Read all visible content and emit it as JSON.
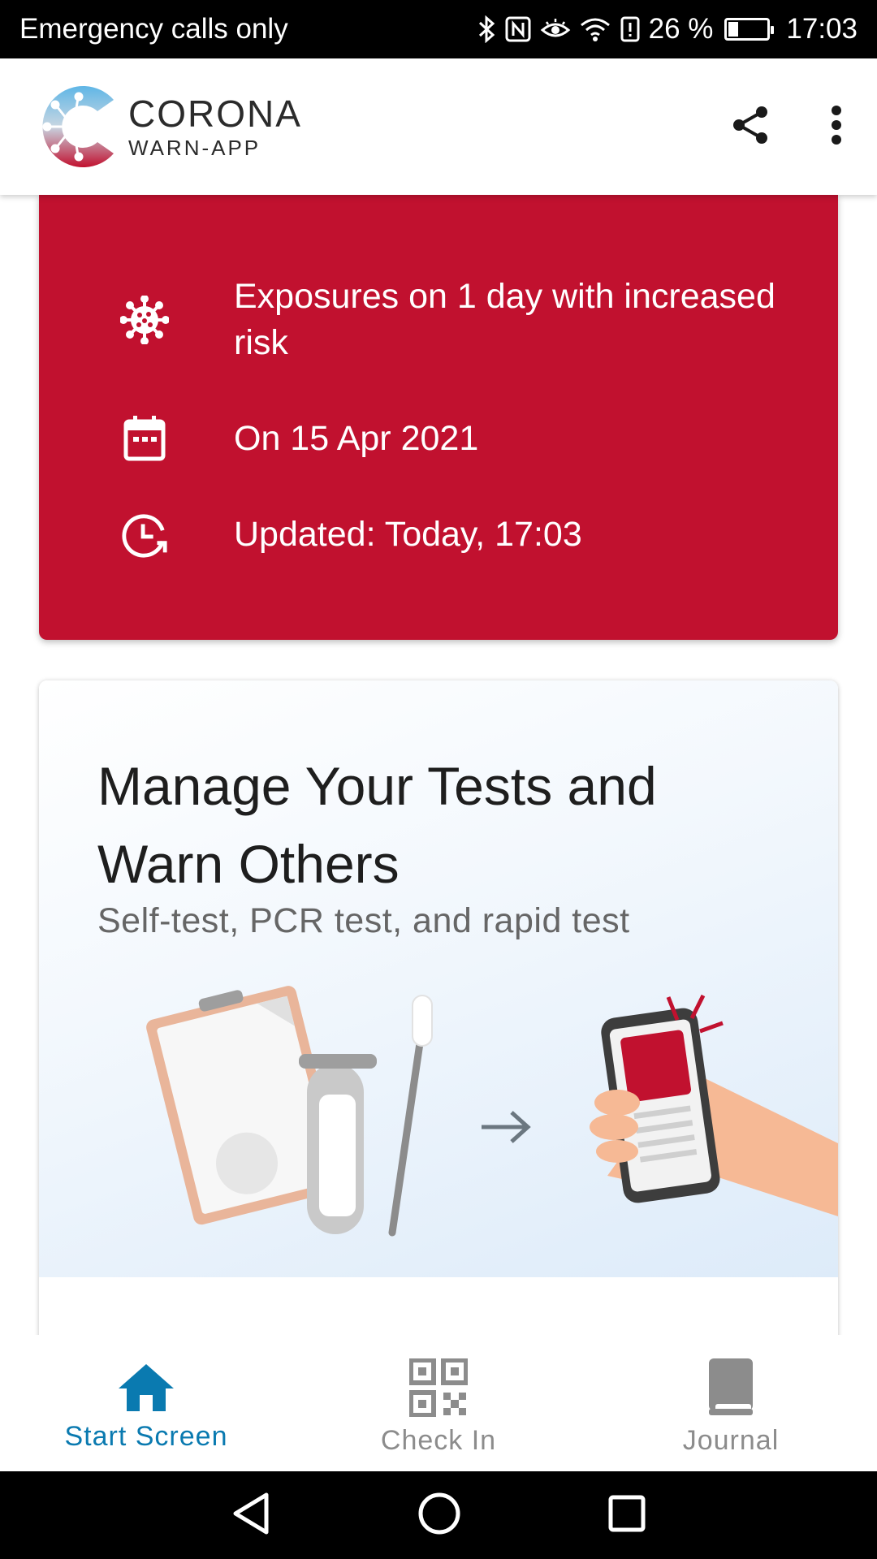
{
  "status_bar": {
    "carrier": "Emergency calls only",
    "battery": "26 %",
    "battery_level": 0.26,
    "time": "17:03",
    "icons": [
      "bluetooth-icon",
      "nfc-icon",
      "eye-comfort-icon",
      "wifi-icon",
      "battery-alert-icon"
    ]
  },
  "app_bar": {
    "brand_title": "CORONA",
    "brand_subtitle": "WARN-APP",
    "share_icon": "share-icon",
    "menu_icon": "more-vert-icon"
  },
  "risk_card": {
    "color": "#c1112f",
    "rows": [
      {
        "icon": "virus-icon",
        "text": "Exposures on 1 day with increased risk"
      },
      {
        "icon": "calendar-icon",
        "text": "On 15 Apr 2021"
      },
      {
        "icon": "clock-refresh-icon",
        "text": "Updated: Today, 17:03"
      }
    ]
  },
  "tests_card": {
    "title": "Manage Your Tests and Warn Others",
    "subtitle": "Self-test, PCR test, and rapid test"
  },
  "bottom_nav": {
    "items": [
      {
        "label": "Start Screen",
        "icon": "home-icon",
        "active": true
      },
      {
        "label": "Check In",
        "icon": "qr-code-icon",
        "active": false
      },
      {
        "label": "Journal",
        "icon": "book-icon",
        "active": false
      }
    ],
    "active_color": "#0a7ab0"
  }
}
